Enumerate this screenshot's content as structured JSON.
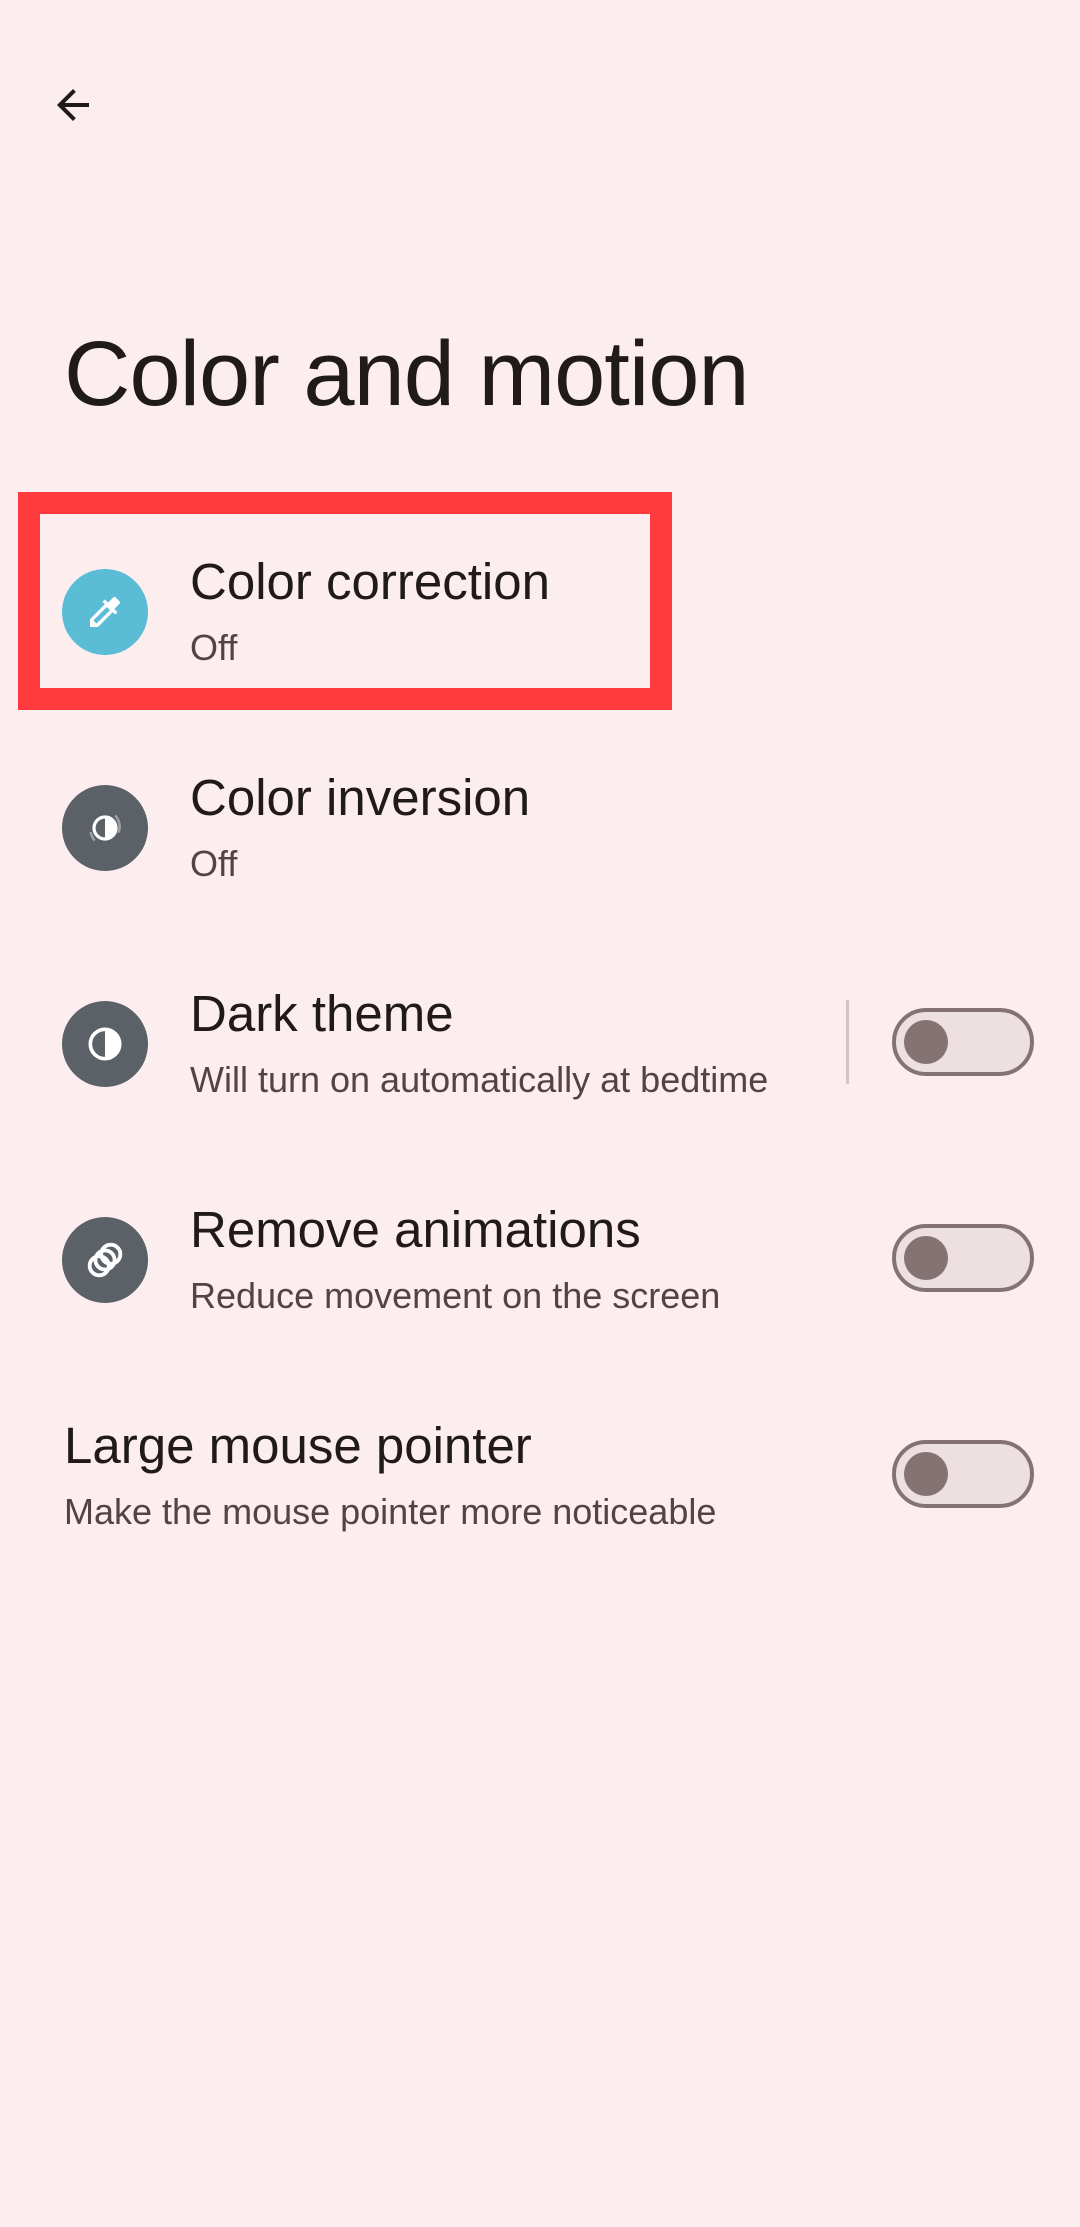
{
  "header": {
    "back_icon": "arrow-back-icon",
    "title": "Color and motion"
  },
  "settings": [
    {
      "title": "Color correction",
      "summary": "Off",
      "icon": "eyedropper-icon",
      "icon_bg": "#5BBCD6",
      "control": "none",
      "highlighted": true
    },
    {
      "title": "Color inversion",
      "summary": "Off",
      "icon": "color-inversion-icon",
      "icon_bg": "#5C6168",
      "control": "none"
    },
    {
      "title": "Dark theme",
      "summary": "Will turn on automatically at bedtime",
      "icon": "contrast-icon",
      "icon_bg": "#5C6168",
      "control": "toggle",
      "toggle_on": false
    },
    {
      "title": "Remove animations",
      "summary": "Reduce movement on the screen",
      "icon": "animation-icon",
      "icon_bg": "#5C6168",
      "control": "toggle",
      "toggle_on": false
    },
    {
      "title": "Large mouse pointer",
      "summary": "Make the mouse pointer more noticeable",
      "icon": null,
      "control": "toggle",
      "toggle_on": false
    }
  ],
  "colors": {
    "background": "#FCEEEE",
    "highlight": "#FF3B3F",
    "text_primary": "#201A1B",
    "text_secondary": "#524345",
    "toggle_outline": "#857374"
  }
}
